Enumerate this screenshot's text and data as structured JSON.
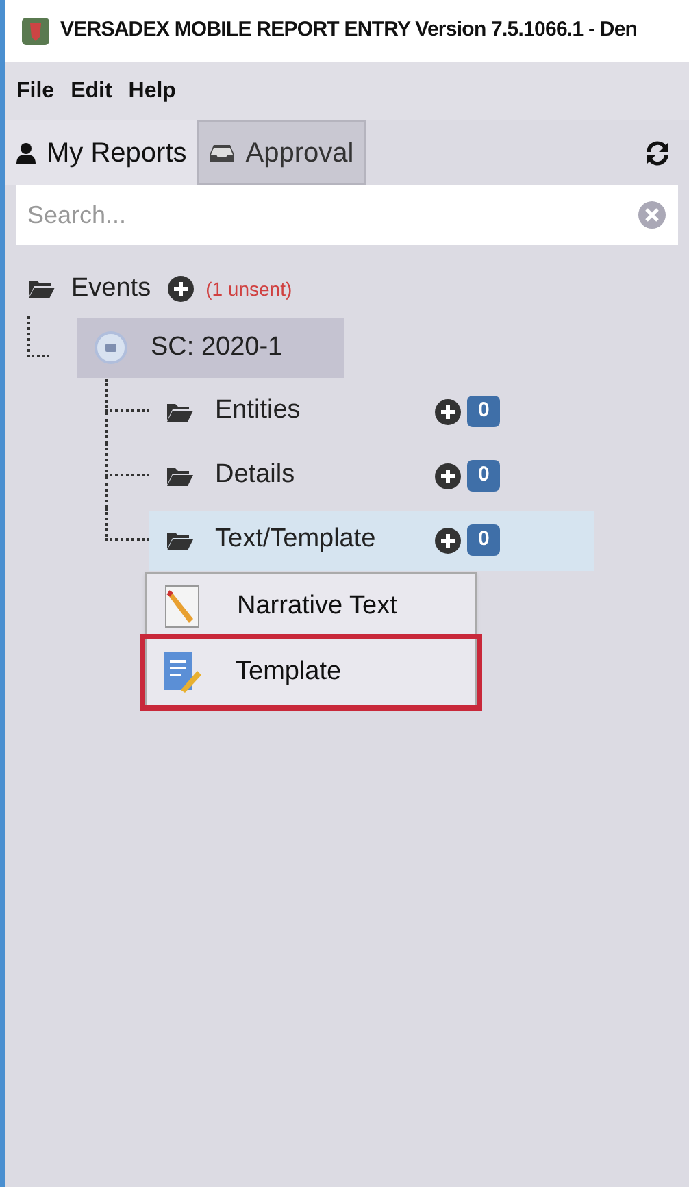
{
  "window": {
    "title": "VERSADEX MOBILE REPORT ENTRY Version 7.5.1066.1 - Den"
  },
  "menu": [
    "File",
    "Edit",
    "Help"
  ],
  "tabs": [
    {
      "label": "My Reports",
      "kind": "user",
      "selected": true
    },
    {
      "label": "Approval",
      "kind": "inbox",
      "selected": false
    }
  ],
  "search": {
    "placeholder": "Search..."
  },
  "tree": {
    "label": "Events",
    "note": "(1 unsent)",
    "children": [
      {
        "label": "SC: 2020-1",
        "selected": true,
        "children": [
          {
            "label": "Entities",
            "count": "0",
            "selected": false
          },
          {
            "label": "Details",
            "count": "0",
            "selected": false
          },
          {
            "label": "Text/Template",
            "count": "0",
            "selected": true
          }
        ]
      }
    ]
  },
  "context_menu": [
    {
      "label": "Narrative Text",
      "kind": "pencil",
      "highlighted": false
    },
    {
      "label": "Template",
      "kind": "form",
      "highlighted": true
    }
  ]
}
